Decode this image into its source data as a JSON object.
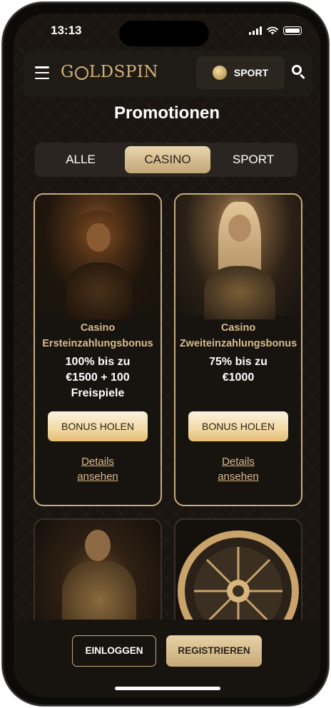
{
  "status_bar": {
    "time": "13:13"
  },
  "header": {
    "logo_parts": {
      "prefix": "G",
      "suffix": "LDSPIN"
    },
    "sport_label": "SPORT"
  },
  "page_title": "Promotionen",
  "tabs": [
    {
      "label": "ALLE",
      "active": false
    },
    {
      "label": "CASINO",
      "active": true
    },
    {
      "label": "SPORT",
      "active": false
    }
  ],
  "promotions": [
    {
      "title_line1": "Casino",
      "title_line2": "Ersteinzahlungsbonus",
      "offer_lines": [
        "100% bis zu",
        "€1500 + 100",
        "Freispiele"
      ],
      "button_label": "BONUS HOLEN",
      "details_line1": "Details",
      "details_line2": "ansehen"
    },
    {
      "title_line1": "Casino",
      "title_line2": "Zweiteinzahlungsbonus",
      "offer_lines": [
        "75% bis zu",
        "€1000"
      ],
      "button_label": "BONUS HOLEN",
      "details_line1": "Details",
      "details_line2": "ansehen"
    }
  ],
  "bottom_bar": {
    "login_label": "EINLOGGEN",
    "register_label": "REGISTRIEREN"
  },
  "colors": {
    "accent_gold": "#c9ac7d",
    "background": "#1a1510",
    "button_gold": "#f2d8a3"
  }
}
